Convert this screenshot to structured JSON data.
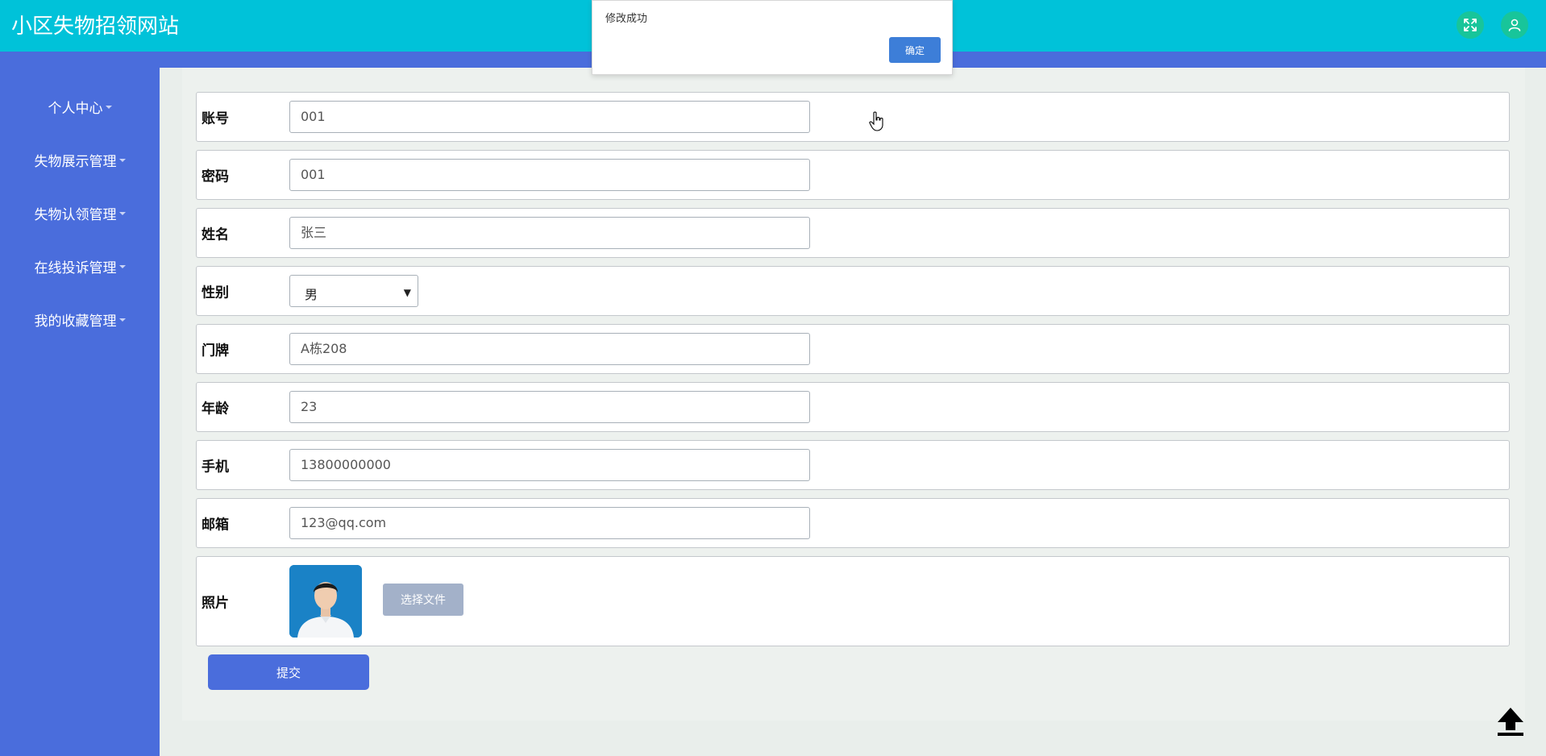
{
  "app": {
    "title": "小区失物招领网站"
  },
  "sidebar": {
    "items": [
      {
        "label": "个人中心"
      },
      {
        "label": "失物展示管理"
      },
      {
        "label": "失物认领管理"
      },
      {
        "label": "在线投诉管理"
      },
      {
        "label": "我的收藏管理"
      }
    ]
  },
  "form": {
    "account": {
      "label": "账号",
      "value": "001"
    },
    "password": {
      "label": "密码",
      "value": "001"
    },
    "name": {
      "label": "姓名",
      "value": "张三"
    },
    "gender": {
      "label": "性别",
      "value": "男"
    },
    "doorplate": {
      "label": "门牌",
      "value": "A栋208"
    },
    "age": {
      "label": "年龄",
      "value": "23"
    },
    "phone": {
      "label": "手机",
      "value": "13800000000"
    },
    "email": {
      "label": "邮箱",
      "value": "123@qq.com"
    },
    "photo": {
      "label": "照片",
      "choose_file_label": "选择文件"
    },
    "submit_label": "提交"
  },
  "dialog": {
    "message": "修改成功",
    "ok_label": "确定"
  },
  "colors": {
    "topbar": "#00c2d9",
    "sidebar": "#4a6ddc",
    "primary_button": "#4a6ddc",
    "dialog_button": "#3d7ed8"
  },
  "icons": {
    "fullscreen": "fullscreen-icon",
    "user": "user-icon",
    "back_to_top": "upload-arrow-icon"
  }
}
